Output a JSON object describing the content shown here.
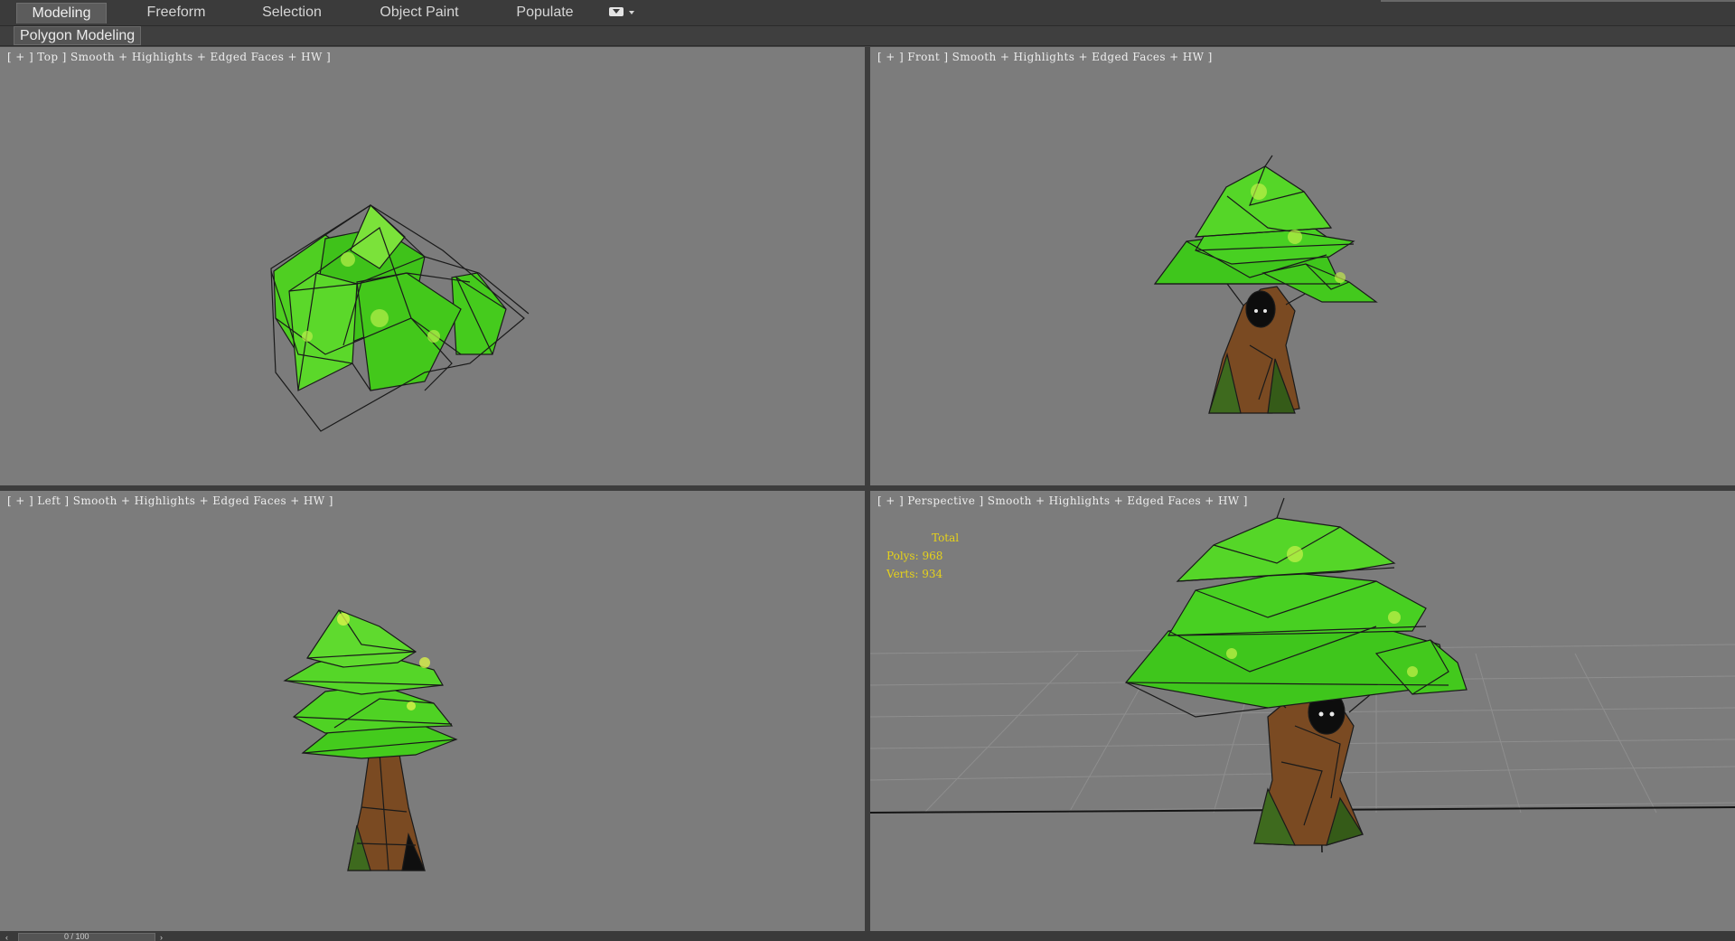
{
  "ribbon": {
    "tabs": [
      {
        "label": "Modeling",
        "active": true
      },
      {
        "label": "Freeform",
        "active": false
      },
      {
        "label": "Selection",
        "active": false
      },
      {
        "label": "Object Paint",
        "active": false
      },
      {
        "label": "Populate",
        "active": false
      }
    ],
    "dropdown_icon": "ribbon-options-icon"
  },
  "panel": {
    "title": "Polygon Modeling"
  },
  "viewports": {
    "top": {
      "label": "[ + ] Top ] Smooth + Highlights + Edged Faces + HW ]"
    },
    "front": {
      "label": "[ + ] Front ] Smooth + Highlights + Edged Faces + HW ]"
    },
    "left": {
      "label": "[ + ] Left ] Smooth + Highlights + Edged Faces + HW ]"
    },
    "perspective": {
      "label": "[ + ] Perspective ] Smooth + Highlights + Edged Faces + HW ]",
      "stats": {
        "header": "Total",
        "polys": "Polys: 968",
        "verts": "Verts: 934"
      }
    }
  },
  "timeline": {
    "frame_label": "0 / 100"
  },
  "colors": {
    "viewport_bg": "#7c7c7c",
    "leaf_green": "#3fd11e",
    "leaf_highlight": "#b7f03a",
    "trunk_brown": "#7a4a22",
    "stats_yellow": "#e6d21a"
  }
}
